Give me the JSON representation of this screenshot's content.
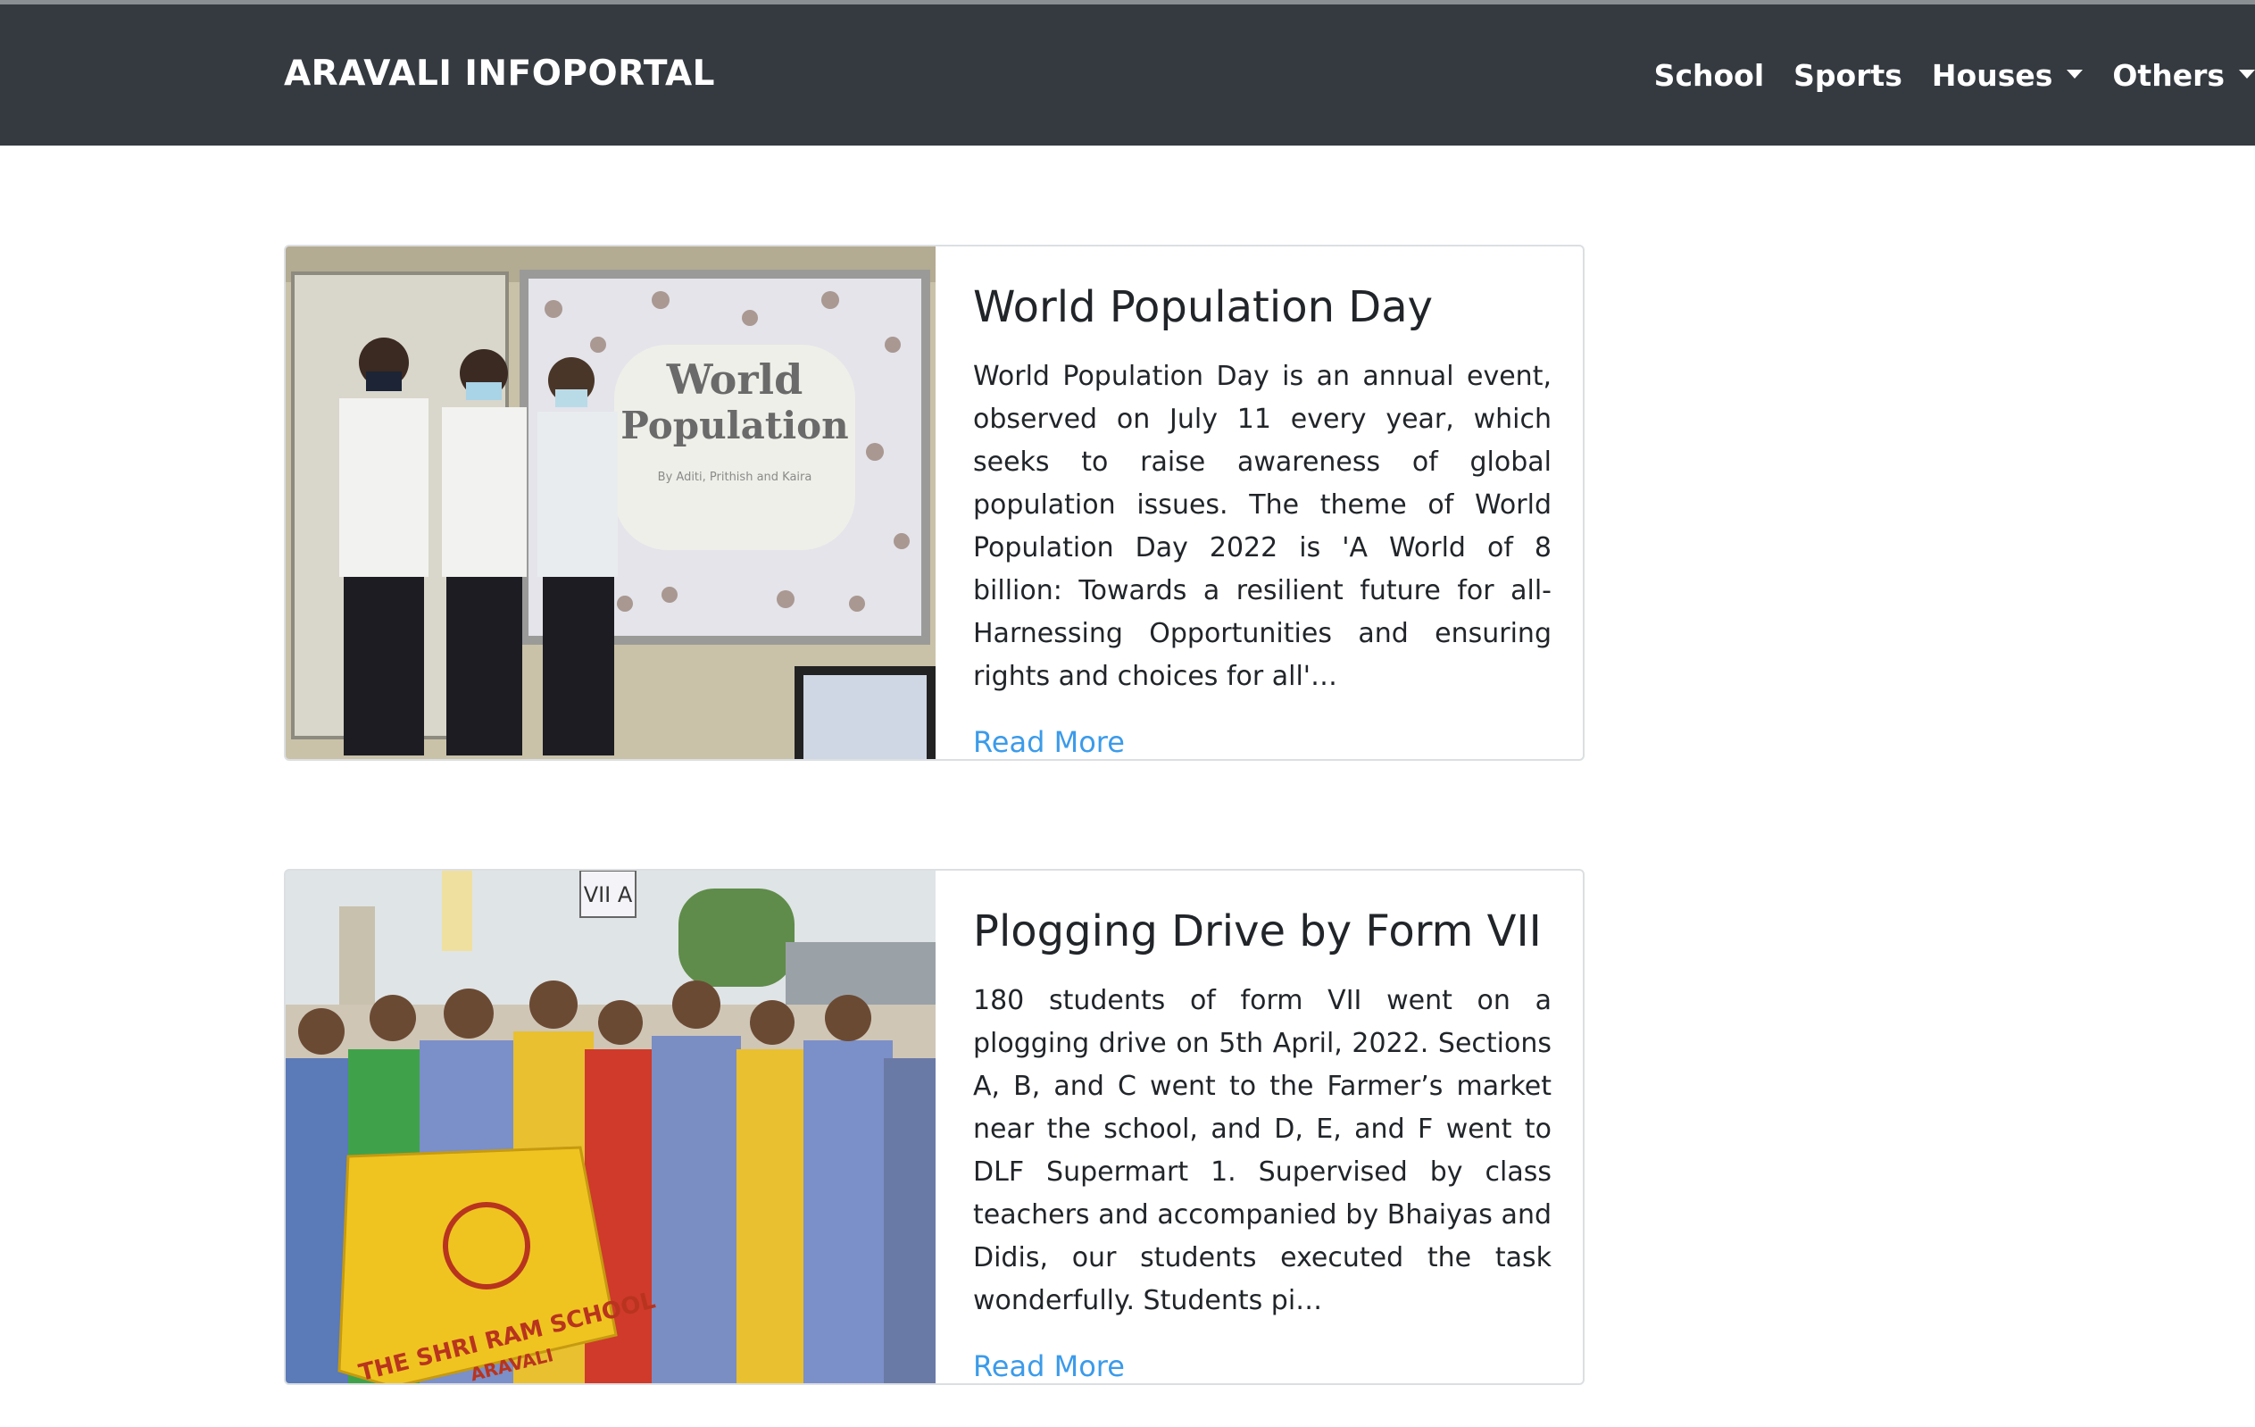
{
  "navbar": {
    "brand": "ARAVALI INFOPORTAL",
    "links": {
      "school": "School",
      "sports": "Sports",
      "houses": "Houses",
      "others": "Others"
    }
  },
  "posts": [
    {
      "title": "World Population Day",
      "excerpt": "World Population Day is an annual event, observed on July 11 every year, which seeks to raise awareness of global population issues. The theme of World Population Day 2022 is 'A World of 8 billion: Towards a resilient future for all- Harnessing Opportunities and ensuring rights and choices for all'…",
      "read_more": "Read More",
      "image_text": {
        "slide_line1": "World",
        "slide_line2": "Population",
        "slide_byline": "By Aditi, Prithish and Kaira"
      }
    },
    {
      "title": "Plogging Drive by Form VII",
      "excerpt": "180 students of form VII went on a plogging drive on 5th April, 2022. Sections A, B, and C went to the Farmer’s market near the school, and D, E, and F went to DLF Supermart 1. Supervised by class teachers and accompanied by Bhaiyas and Didis, our students executed the task wonderfully. Students pi…",
      "read_more": "Read More",
      "image_text": {
        "sign": "VII A",
        "banner": "THE SHRI RAM SCHOOL",
        "banner_sub": "ARAVALI"
      }
    }
  ],
  "colors": {
    "navbar_bg": "#343a40",
    "link": "#3b9bea",
    "text": "#212529"
  }
}
